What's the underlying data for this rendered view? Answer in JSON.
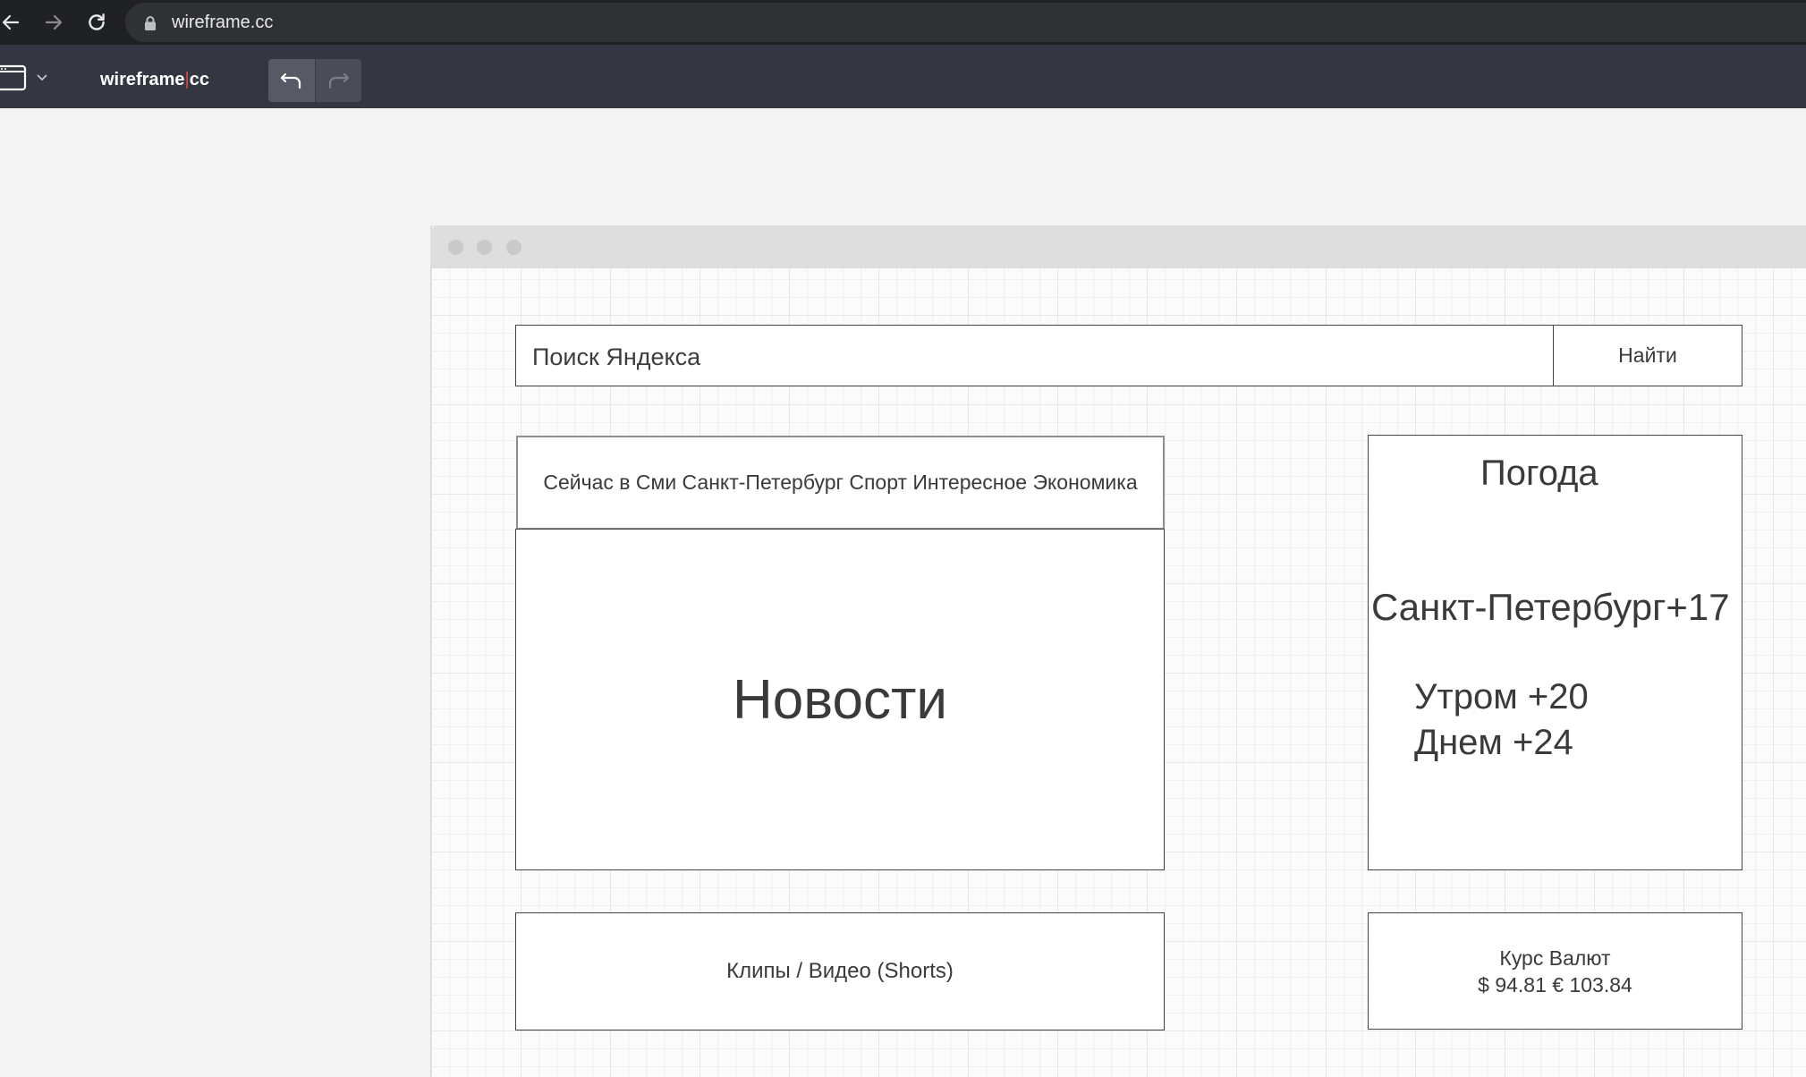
{
  "browser": {
    "url": "wireframe.cc"
  },
  "toolbar": {
    "logo_left": "wireframe",
    "logo_sep": "|",
    "logo_right": "cc"
  },
  "wireframe": {
    "search": {
      "placeholder": "Поиск Яндекса",
      "button": "Найти"
    },
    "news": {
      "tabs": "Сейчас в Сми Санкт-Петербург Спорт Интересное Экономика",
      "title": "Новости"
    },
    "weather": {
      "title": "Погода",
      "city": "Санкт-Петербург+17",
      "morning": "Утром +20",
      "day": "Днем +24"
    },
    "clips": {
      "label": "Клипы / Видео (Shorts)"
    },
    "currency": {
      "title": "Курс Валют",
      "rates": "$ 94.81 € 103.84"
    }
  }
}
